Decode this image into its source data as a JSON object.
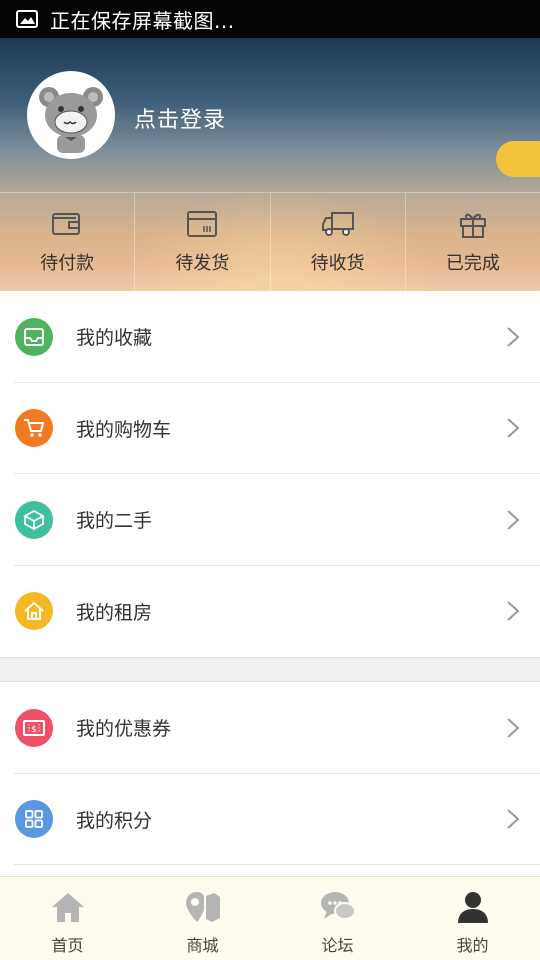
{
  "status_bar": {
    "notification": "正在保存屏幕截图..."
  },
  "profile": {
    "login_prompt": "点击登录"
  },
  "orders": [
    {
      "label": "待付款",
      "icon": "wallet-icon"
    },
    {
      "label": "待发货",
      "icon": "package-icon"
    },
    {
      "label": "待收货",
      "icon": "truck-icon"
    },
    {
      "label": "已完成",
      "icon": "gift-icon"
    }
  ],
  "menu": [
    {
      "label": "我的收藏",
      "icon": "inbox-icon",
      "color": "#4db35c"
    },
    {
      "label": "我的购物车",
      "icon": "cart-icon",
      "color": "#f07b22"
    },
    {
      "label": "我的二手",
      "icon": "box-icon",
      "color": "#3fbf9c"
    },
    {
      "label": "我的租房",
      "icon": "house-icon",
      "color": "#f4b826"
    }
  ],
  "menu2": [
    {
      "label": "我的优惠券",
      "icon": "coupon-icon",
      "color": "#ef4f67"
    },
    {
      "label": "我的积分",
      "icon": "grid-icon",
      "color": "#5a98e0"
    }
  ],
  "tabs": [
    {
      "label": "首页",
      "icon": "home-icon"
    },
    {
      "label": "商城",
      "icon": "map-pin-icon"
    },
    {
      "label": "论坛",
      "icon": "chat-icon"
    },
    {
      "label": "我的",
      "icon": "user-icon"
    }
  ],
  "colors": {
    "accent_pill": "#f3c43a",
    "tab_active": "#333333",
    "tab_inactive": "#b5b5b5"
  }
}
